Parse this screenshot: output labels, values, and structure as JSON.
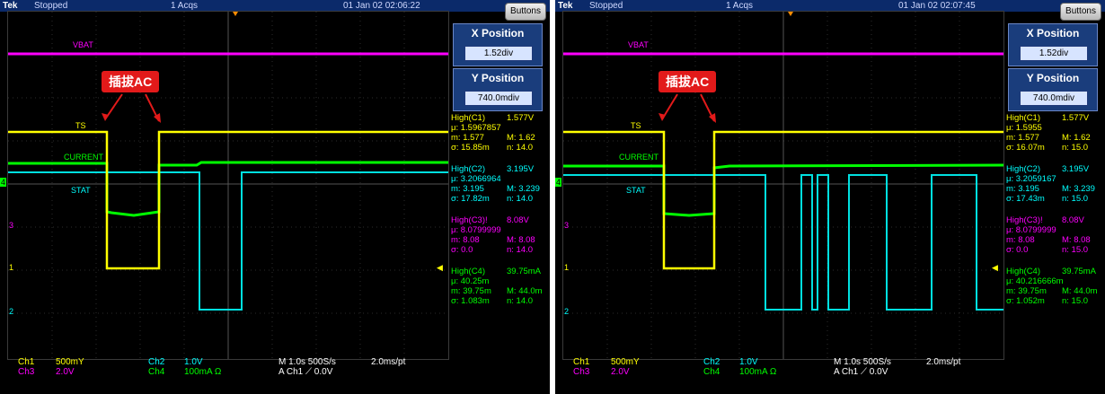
{
  "panels": [
    {
      "header": {
        "brand": "Tek",
        "status": "Stopped",
        "acqs": "1 Acqs",
        "datetime": "01 Jan 02 02:06:22"
      },
      "buttons_label": "Buttons",
      "x_position": {
        "title": "X Position",
        "value": "1.52div"
      },
      "y_position": {
        "title": "Y Position",
        "value": "740.0mdiv"
      },
      "trace_labels": {
        "vbat": "VBAT",
        "ts": "TS",
        "current": "CURRENT",
        "stat": "STAT"
      },
      "annotation": "插拔AC",
      "markers": {
        "ch4": "4",
        "ch3": "3",
        "ch1": "1",
        "ch2": "2"
      },
      "measurements": [
        {
          "title": "High(C1)",
          "value": "1.577V",
          "mu": "μ: 1.5967857",
          "m": "m: 1.577",
          "M": "M: 1.62",
          "sigma": "σ: 15.85m",
          "n": "n: 14.0",
          "color": "#ffff00"
        },
        {
          "title": "High(C2)",
          "value": "3.195V",
          "mu": "μ: 3.2066964",
          "m": "m: 3.195",
          "M": "M: 3.239",
          "sigma": "σ: 17.82m",
          "n": "n: 14.0",
          "color": "#00ffff"
        },
        {
          "title": "High(C3)!",
          "value": "8.08V",
          "mu": "μ: 8.0799999",
          "m": "m: 8.08",
          "M": "M: 8.08",
          "sigma": "σ: 0.0",
          "n": "n: 14.0",
          "color": "#ff00ff"
        },
        {
          "title": "High(C4)",
          "value": "39.75mA",
          "mu": "μ: 40.25m",
          "m": "m: 39.75m",
          "M": "M: 44.0m",
          "sigma": "σ: 1.083m",
          "n": "n: 14.0",
          "color": "#00ff00"
        }
      ],
      "bottom": {
        "ch1": "Ch1",
        "ch1_scale": "500mY",
        "ch3": "Ch3",
        "ch3_scale": "2.0V",
        "ch2": "Ch2",
        "ch2_scale": "1.0V",
        "ch4": "Ch4",
        "ch4_scale": "100mA  Ω",
        "timebase": "M 1.0s 500S/s",
        "trigger": "A  Ch1  ⟋  0.0V",
        "record": "2.0ms/pt"
      }
    },
    {
      "header": {
        "brand": "Tek",
        "status": "Stopped",
        "acqs": "1 Acqs",
        "datetime": "01 Jan 02 02:07:45"
      },
      "buttons_label": "Buttons",
      "x_position": {
        "title": "X Position",
        "value": "1.52div"
      },
      "y_position": {
        "title": "Y Position",
        "value": "740.0mdiv"
      },
      "trace_labels": {
        "vbat": "VBAT",
        "ts": "TS",
        "current": "CURRENT",
        "stat": "STAT"
      },
      "annotation": "插拔AC",
      "markers": {
        "ch4": "4",
        "ch3": "3",
        "ch1": "1",
        "ch2": "2"
      },
      "measurements": [
        {
          "title": "High(C1)",
          "value": "1.577V",
          "mu": "μ: 1.5955",
          "m": "m: 1.577",
          "M": "M: 1.62",
          "sigma": "σ: 16.07m",
          "n": "n: 15.0",
          "color": "#ffff00"
        },
        {
          "title": "High(C2)",
          "value": "3.195V",
          "mu": "μ: 3.2059167",
          "m": "m: 3.195",
          "M": "M: 3.239",
          "sigma": "σ: 17.43m",
          "n": "n: 15.0",
          "color": "#00ffff"
        },
        {
          "title": "High(C3)!",
          "value": "8.08V",
          "mu": "μ: 8.0799999",
          "m": "m: 8.08",
          "M": "M: 8.08",
          "sigma": "σ: 0.0",
          "n": "n: 15.0",
          "color": "#ff00ff"
        },
        {
          "title": "High(C4)",
          "value": "39.75mA",
          "mu": "μ: 40.216666m",
          "m": "m: 39.75m",
          "M": "M: 44.0m",
          "sigma": "σ: 1.052m",
          "n": "n: 15.0",
          "color": "#00ff00"
        }
      ],
      "bottom": {
        "ch1": "Ch1",
        "ch1_scale": "500mY",
        "ch3": "Ch3",
        "ch3_scale": "2.0V",
        "ch2": "Ch2",
        "ch2_scale": "1.0V",
        "ch4": "Ch4",
        "ch4_scale": "100mA  Ω",
        "timebase": "M 1.0s 500S/s",
        "trigger": "A  Ch1  ⟋  0.0V",
        "record": "2.0ms/pt"
      }
    }
  ],
  "colors": {
    "ch1": "#ffff00",
    "ch2": "#00ffff",
    "ch3": "#ff00ff",
    "ch4": "#00ff00",
    "annotation": "#e21a1a"
  }
}
